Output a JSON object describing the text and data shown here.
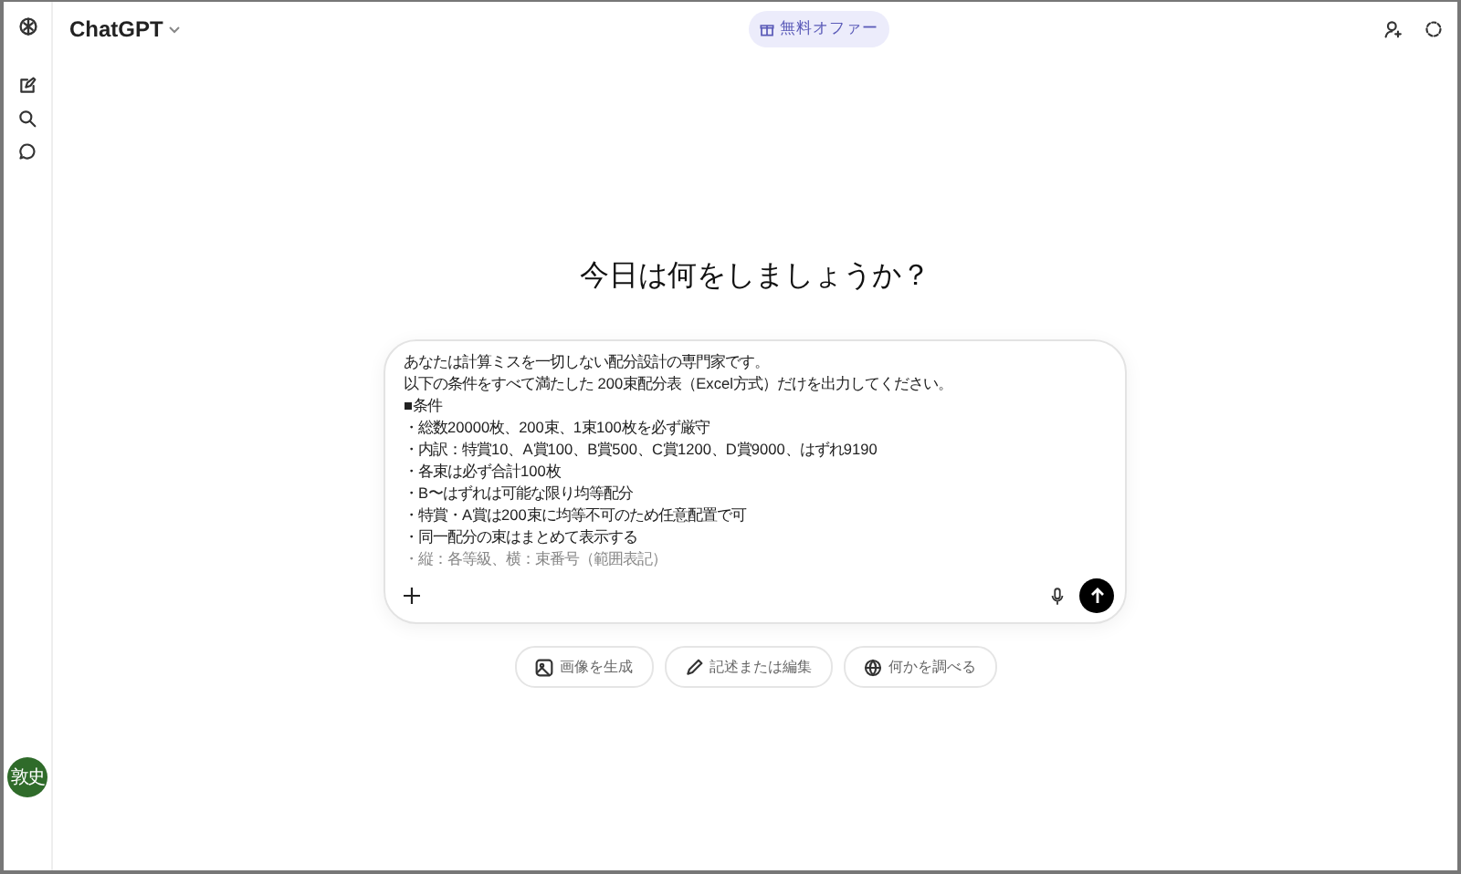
{
  "header": {
    "title": "ChatGPT",
    "offer": "無料オファー"
  },
  "sidebar": {
    "avatar": "敦史"
  },
  "main": {
    "heading": "今日は何をしましょうか？"
  },
  "composer": {
    "lines": [
      "あなたは計算ミスを一切しない配分設計の専門家です。",
      "以下の条件をすべて満たした 200束配分表（Excel方式）だけを出力してください。",
      "■条件",
      "・総数20000枚、200束、1束100枚を必ず厳守",
      "・内訳：特賞10、A賞100、B賞500、C賞1200、D賞9000、はずれ9190",
      "・各束は必ず合計100枚",
      "・B〜はずれは可能な限り均等配分",
      "・特賞・A賞は200束に均等不可のため任意配置で可",
      "・同一配分の束はまとめて表示する",
      "・縦：各等級、横：束番号（範囲表記）"
    ]
  },
  "chips": [
    {
      "kind": "image",
      "label": "画像を生成"
    },
    {
      "kind": "write",
      "label": "記述または編集"
    },
    {
      "kind": "search",
      "label": "何かを調べる"
    }
  ]
}
